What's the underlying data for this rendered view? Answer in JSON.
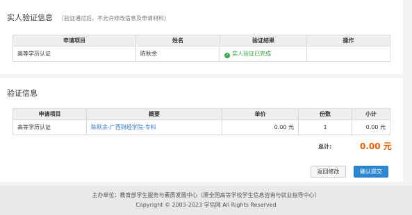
{
  "real_name": {
    "title": "实人验证信息",
    "note": "（验证通过后，不允许修改信息及申请材料）",
    "headers": [
      "申请项目",
      "姓名",
      "验证结果",
      "操作"
    ],
    "row": {
      "item": "高等学历认证",
      "name": "陈秋余",
      "result": "实人验证已完成",
      "action": ""
    }
  },
  "verify": {
    "title": "验证信息",
    "headers": [
      "申请项目",
      "概要",
      "单价",
      "份数",
      "小计"
    ],
    "row": {
      "item": "高等学历认证",
      "summary": "陈秋余-广西财经学院-专科",
      "price": "0.00 元",
      "qty": "1",
      "subtotal": "0.00 元"
    },
    "total_label": "总计:",
    "total_value": "0.00 元"
  },
  "buttons": {
    "back": "返回修改",
    "confirm": "确认提交"
  },
  "footer": {
    "line1": "主办单位：教育部学生服务与素质发展中心（原全国高等学校学生信息咨询与就业指导中心）",
    "line2": "Copyright  ©  2003-2023  学信网  All Rights Reserved"
  },
  "colors": {
    "success": "#2f9e3c",
    "link": "#2f6fc2",
    "total": "#f05a00",
    "primary_button": "#2d86d2"
  }
}
